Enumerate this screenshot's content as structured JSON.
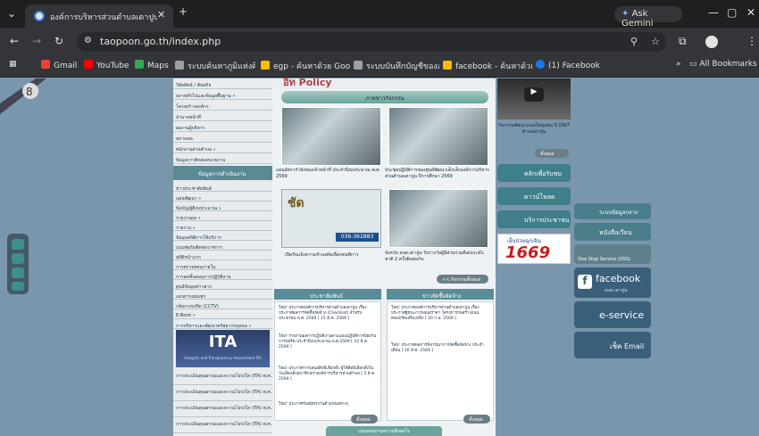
{
  "browser": {
    "tab_title": "องค์การบริหารส่วนตำบลเตาปูน อำเภ",
    "new_tab": "+",
    "gemini_label": "Ask Gemini",
    "url": "taopoon.go.th/index.php",
    "bookmarks": [
      {
        "label": "Gmail",
        "color": "#ea4335"
      },
      {
        "label": "YouTube",
        "color": "#ff0000"
      },
      {
        "label": "Maps",
        "color": "#34a853"
      },
      {
        "label": "ระบบค้นหาภูมิแห่งศิลป์ม",
        "color": "#9aa0a6"
      },
      {
        "label": "egp - ค้นหาด้วย Goo...",
        "color": "#fbbc05"
      },
      {
        "label": "ระบบบันทึกบัญชีขององ...",
        "color": "#9aa0a6"
      },
      {
        "label": "facebook - ค้นหาด้วย...",
        "color": "#fbbc05"
      },
      {
        "label": "(1) Facebook",
        "color": "#1877f2"
      }
    ],
    "all_bookmarks": "All Bookmarks"
  },
  "nav": {
    "items_top": [
      "วิสัยทัศน์ / พันธกิจ",
      "สภาพทั่วไปและข้อมูลพื้นฐาน »",
      "โครงสร้างองค์กร",
      "อำนาจหน้าที่",
      "ผลงานผู้บริหาร",
      "สภาอบต.",
      "พนักงานส่วนตำบล »",
      "ข้อมูลการติดต่อหน่วยงาน"
    ],
    "section_title": "ข้อมูลการดำเนินงาน",
    "items_bottom": [
      "ข่าวประชาสัมพันธ์",
      "แผนพัฒนา »",
      "ข้อบัญญัติงบประมาณ »",
      "รายงานผล »",
      "รายงาน »",
      "ข้อมูลสถิติการให้บริการ",
      "แบบฟอร์มติดต่อราชการ",
      "สถิติหน้าแรก",
      "การตรวจสอบภายใน",
      "การลดขั้นตอนการปฏิบัติงาน",
      "ศูนย์ข้อมูลข่าวสาร",
      "เอกสารเผยแพร่",
      "กล้องวงจรปิด (CCTV)",
      "E-Book »",
      "การบริหารและพัฒนาทรัพยากรบุคคล »"
    ],
    "ita_title": "ITA",
    "ita_sub": "Integrity and Transparency Assessment ITA",
    "ita_items": [
      "การประเมินคุณธรรมและความโปร่งใส (ITA) พ.ศ.2566",
      "การประเมินคุณธรรมและความโปร่งใส (ITA) พ.ศ.2567",
      "การประเมินคุณธรรมและความโปร่งใส (ITA) พ.ศ.2568",
      "การประเมินคุณธรรมและความโปร่งใส (ITA) พ.ศ.2569"
    ]
  },
  "main": {
    "banner_text": "อิท Policy",
    "activities_title": "ภาพข่าวกิจกรรม",
    "news": [
      "แผนอัตรากำลังของเจ้าหน้าที่ ประจำปีงบประมาณ พ.ศ. 2569",
      "ประชุมปฏิบัติการของศูนย์พัฒนาเด็กเล็กองค์การบริหารส่วนตำบลเตาปูน ปีการศึกษา 2569",
      "เปิดรับแจ้งความจำนงคัดเลือกคนพิการ",
      "จังหวัด อบต.เตาปูน รับรางวัลผู้มีส่วนร่วมดีเด่นระดับชาติ 2 ครั้งติดต่อกัน"
    ],
    "ita_badge": "ชัด",
    "phone": "036-362883",
    "more_activities": "<< กิจกรรมทั้งหมด",
    "ann_title": "ประชาสัมพันธ์",
    "ann_items": [
      {
        "text": "ใหม่! ประกาศองค์การบริหารส่วนตำบลเตาปูน เรื่อง ประกาศผลการจัดซื้อจัดจ้าง (Checklist) สำหรับประชาชน พ.ศ. 2569",
        "date": "[ 15 มี.ค. 2569 ]"
      },
      {
        "text": "ใหม่! รายงานผลการปฏิบัติงานตามแผนปฏิบัติการป้องกันการทุจริต ประจำปีงบประมาณ พ.ศ.2569",
        "date": "[ 10 มี.ค. 2569 ]"
      },
      {
        "text": "ใหม่! ประกาศการเสนอสิทธิเลือกตั้ง ผู้ใช้สิทธิเลือกตั้งในวันเลือกตั้งสมาชิกสภาองค์การบริหารส่วนตำบล",
        "date": "[ 5 มี.ค. 2569 ]"
      },
      {
        "text": "ใหม่! ประกาศรับสมัครงานตำแหน่งต่างๆ",
        "date": ""
      }
    ],
    "news_title": "ข่าวจัดซื้อจัดจ้าง",
    "news_items": [
      {
        "text": "ใหม่! ประกาศองค์การบริหารส่วนตำบลเตาปูน เรื่อง ประกาศผู้ชนะการเสนอราคา โครงการก่อสร้างถนนคอนกรีตเสริมเหล็ก",
        "date": "[ 20 ก.พ. 2569 ]"
      },
      {
        "text": "ใหม่! ประกาศผลการพิจารณาการจัดซื้อจัดจ้าง ประจำเดือน",
        "date": "[ 16 มี.ค. 2569 ]"
      }
    ],
    "more": "ทั้งหมด",
    "footer_bar": "แบบสอบถามความพึงพอใจ"
  },
  "right": {
    "video_caption": "กิจกรรมพัฒนาถนนในชุมชน ปี 2567 ตำบลเตาปูน",
    "more_btn": "ทั้งหมด",
    "buttons": [
      {
        "label": "คลิกเพื่อรับชม",
        "color": "#3f7f8a"
      },
      {
        "label": "ดาวน์โหลด",
        "color": "#3f7f8a"
      },
      {
        "label": "บริการประชาชน",
        "color": "#3f7f8a"
      }
    ],
    "hotline_text": "เจ็บป่วยฉุกเฉิน",
    "hotline_number": "1669"
  },
  "far_right": {
    "links": [
      {
        "label": "ระบบข้อมูลกลาง",
        "color": "#4a7e8a"
      },
      {
        "label": "หนังสือเวียน",
        "color": "#4a7e8a"
      },
      {
        "label": "One Stop Service (OSS)",
        "color": "#5f7f8a"
      },
      {
        "label": "facebook",
        "color": "#3a5f7a"
      },
      {
        "label": "e-service",
        "color": "#3a5f7a"
      },
      {
        "label": "เช็ค Email",
        "color": "#3a5f7a"
      }
    ],
    "facebook_sub": "อบต.เตาปูน"
  }
}
